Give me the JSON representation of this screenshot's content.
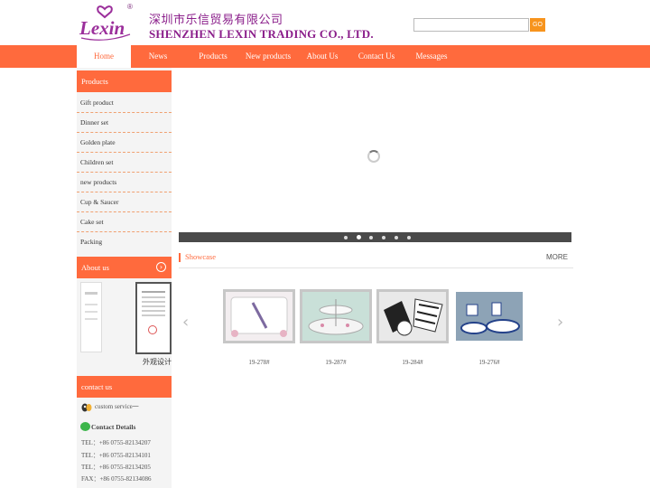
{
  "header": {
    "logo_text": "Lexin",
    "registered_mark": "®",
    "company_cn": "深圳市乐信贸易有限公司",
    "company_en": "SHENZHEN LEXIN TRADING CO., LTD.",
    "search": {
      "value": "",
      "placeholder": "",
      "button_label": "GO"
    }
  },
  "nav": {
    "items": [
      {
        "label": "Home",
        "active": true
      },
      {
        "label": "News"
      },
      {
        "label": "Products"
      },
      {
        "label": "New products"
      },
      {
        "label": "About Us"
      },
      {
        "label": "Contact Us"
      },
      {
        "label": "Messages"
      }
    ]
  },
  "sidebar": {
    "products_title": "Products",
    "products": [
      "Gift product",
      "Dinner set",
      "Golden plate",
      "Children  set",
      "new products",
      "Cup & Saucer",
      "Cake set",
      "Packing"
    ],
    "about_title": "About us",
    "about_caption": "外观设计",
    "contact_title": "contact us",
    "custom_service": "custom service一",
    "contact_details_title": "Contact Details",
    "contact_lines": [
      "TEL：+86 0755-82134207",
      "TEL：+86 0755-82134101",
      "TEL：+86 0755-82134205",
      "FAX：+86 0755-82134086"
    ]
  },
  "banner": {
    "dot_count": 6,
    "active_dot": 1
  },
  "showcase": {
    "title": "Showcase",
    "more": "MORE",
    "products": [
      {
        "label": "19-278#"
      },
      {
        "label": "19-287#"
      },
      {
        "label": "19-284#"
      },
      {
        "label": "19-276#"
      }
    ]
  },
  "colors": {
    "accent": "#ff6a3d",
    "brand_purple": "#8b1f8b",
    "search_button": "#f7941d"
  }
}
